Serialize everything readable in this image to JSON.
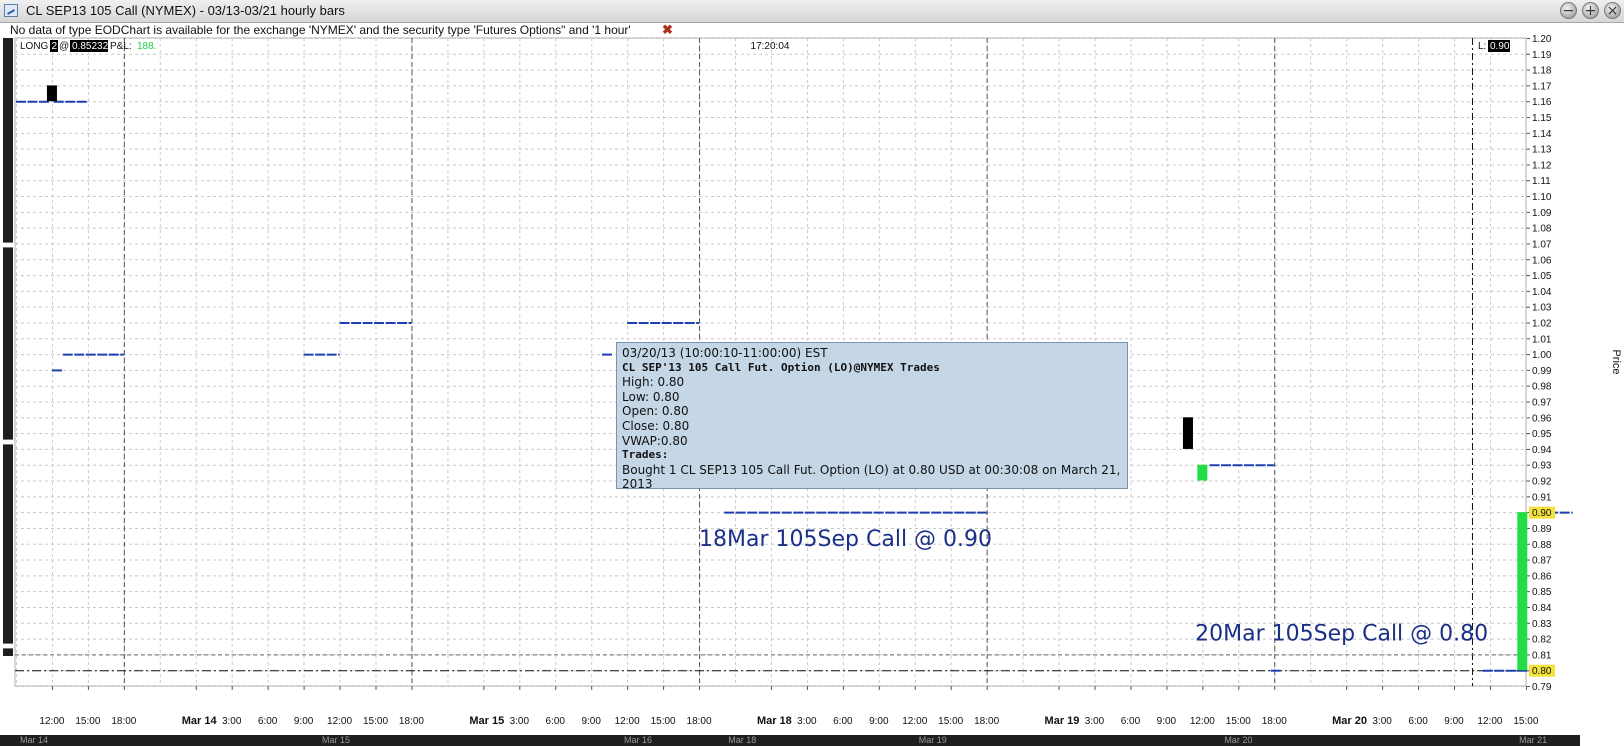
{
  "window": {
    "title": "CL SEP13 105 Call (NYMEX) - 03/13-03/21 hourly bars",
    "minimize_glyph": "−",
    "maximize_glyph": "+",
    "close_glyph": "×"
  },
  "notice": {
    "text": "No data of type EODChart is available for the exchange 'NYMEX' and the security type 'Futures Options\" and '1 hour'",
    "close_glyph": "✖"
  },
  "position_bar": {
    "side": "LONG",
    "qty": "2",
    "at": "@",
    "avg_price": "0.85232",
    "pnl_label": "P&L:",
    "pnl_value": "188."
  },
  "clock": "17:20:04",
  "last_label": "L:",
  "last_value": "0.90",
  "axis": {
    "y_title": "Price",
    "ylim": [
      0.79,
      1.2
    ],
    "y_ticks": [
      "0.79",
      "0.80",
      "0.81",
      "0.82",
      "0.83",
      "0.84",
      "0.85",
      "0.86",
      "0.87",
      "0.88",
      "0.89",
      "0.90",
      "0.91",
      "0.92",
      "0.93",
      "0.94",
      "0.95",
      "0.96",
      "0.97",
      "0.98",
      "0.99",
      "1.00",
      "1.01",
      "1.02",
      "1.03",
      "1.04",
      "1.05",
      "1.06",
      "1.07",
      "1.08",
      "1.09",
      "1.10",
      "1.11",
      "1.12",
      "1.13",
      "1.14",
      "1.15",
      "1.16",
      "1.17",
      "1.18",
      "1.19",
      "1.20"
    ],
    "price_badges": [
      {
        "value": 0.9,
        "text": "0.90"
      },
      {
        "value": 0.8,
        "text": "0.80"
      }
    ],
    "x_ticks": [
      {
        "slot": 1,
        "text": "12:00",
        "bold": false
      },
      {
        "slot": 2,
        "text": "15:00",
        "bold": false
      },
      {
        "slot": 3,
        "text": "18:00",
        "bold": false
      },
      {
        "slot": 5,
        "text": "Mar 14",
        "bold": true
      },
      {
        "slot": 6,
        "text": "3:00",
        "bold": false
      },
      {
        "slot": 7,
        "text": "6:00",
        "bold": false
      },
      {
        "slot": 8,
        "text": "9:00",
        "bold": false
      },
      {
        "slot": 9,
        "text": "12:00",
        "bold": false
      },
      {
        "slot": 10,
        "text": "15:00",
        "bold": false
      },
      {
        "slot": 11,
        "text": "18:00",
        "bold": false
      },
      {
        "slot": 13,
        "text": "Mar 15",
        "bold": true
      },
      {
        "slot": 14,
        "text": "3:00",
        "bold": false
      },
      {
        "slot": 15,
        "text": "6:00",
        "bold": false
      },
      {
        "slot": 16,
        "text": "9:00",
        "bold": false
      },
      {
        "slot": 17,
        "text": "12:00",
        "bold": false
      },
      {
        "slot": 18,
        "text": "15:00",
        "bold": false
      },
      {
        "slot": 19,
        "text": "18:00",
        "bold": false
      },
      {
        "slot": 21,
        "text": "Mar 18",
        "bold": true
      },
      {
        "slot": 22,
        "text": "3:00",
        "bold": false
      },
      {
        "slot": 23,
        "text": "6:00",
        "bold": false
      },
      {
        "slot": 24,
        "text": "9:00",
        "bold": false
      },
      {
        "slot": 25,
        "text": "12:00",
        "bold": false
      },
      {
        "slot": 26,
        "text": "15:00",
        "bold": false
      },
      {
        "slot": 27,
        "text": "18:00",
        "bold": false
      },
      {
        "slot": 29,
        "text": "Mar 19",
        "bold": true
      },
      {
        "slot": 30,
        "text": "3:00",
        "bold": false
      },
      {
        "slot": 31,
        "text": "6:00",
        "bold": false
      },
      {
        "slot": 32,
        "text": "9:00",
        "bold": false
      },
      {
        "slot": 33,
        "text": "12:00",
        "bold": false
      },
      {
        "slot": 34,
        "text": "15:00",
        "bold": false
      },
      {
        "slot": 35,
        "text": "18:00",
        "bold": false
      },
      {
        "slot": 37,
        "text": "Mar 20",
        "bold": true
      },
      {
        "slot": 38,
        "text": "3:00",
        "bold": false
      },
      {
        "slot": 39,
        "text": "6:00",
        "bold": false
      },
      {
        "slot": 40,
        "text": "9:00",
        "bold": false
      },
      {
        "slot": 41,
        "text": "12:00",
        "bold": false
      },
      {
        "slot": 42,
        "text": "15:00",
        "bold": false
      }
    ],
    "session_breaks": [
      3,
      11,
      19,
      27,
      35,
      40.5
    ]
  },
  "chart_data": {
    "type": "candlestick",
    "title": "CL SEP13 105 Call (NYMEX) - 03/13-03/21 hourly bars",
    "ylabel": "Price",
    "ylim": [
      0.79,
      1.2
    ],
    "grid": true,
    "quote_segments": [
      {
        "from": 0.0,
        "to": 0.95,
        "price": 1.16
      },
      {
        "from": 1.05,
        "to": 2.0,
        "price": 1.16
      },
      {
        "from": 1.0,
        "to": 1.3,
        "price": 0.99
      },
      {
        "from": 1.3,
        "to": 3.0,
        "price": 1.0
      },
      {
        "from": 8.0,
        "to": 9.0,
        "price": 1.0
      },
      {
        "from": 9.0,
        "to": 11.0,
        "price": 1.02
      },
      {
        "from": 16.3,
        "to": 16.6,
        "price": 1.0
      },
      {
        "from": 17.0,
        "to": 19.0,
        "price": 1.02
      },
      {
        "from": 19.7,
        "to": 27.0,
        "price": 0.9
      },
      {
        "from": 33.2,
        "to": 35.0,
        "price": 0.93
      },
      {
        "from": 34.9,
        "to": 35.2,
        "price": 0.8
      },
      {
        "from": 40.8,
        "to": 42.2,
        "price": 0.8
      },
      {
        "from": 42.3,
        "to": 43.3,
        "price": 0.9
      }
    ],
    "candles": [
      {
        "slot": 1.0,
        "open": 1.16,
        "high": 1.17,
        "low": 1.16,
        "close": 1.17,
        "color": "#000000"
      },
      {
        "slot": 32.6,
        "open": 0.94,
        "high": 0.96,
        "low": 0.94,
        "close": 0.96,
        "color": "#000000"
      },
      {
        "slot": 33.0,
        "open": 0.92,
        "high": 0.93,
        "low": 0.92,
        "close": 0.93,
        "color": "#22dd44"
      },
      {
        "slot": 41.9,
        "open": 0.8,
        "high": 0.9,
        "low": 0.8,
        "close": 0.9,
        "color": "#22dd44"
      }
    ],
    "reference_lines": [
      {
        "price": 0.8,
        "style": "dashdot"
      },
      {
        "price": 0.81,
        "style": "dashed"
      }
    ],
    "annotations": [
      {
        "slot": 19.0,
        "price": 0.88,
        "text": "18Mar 105Sep Call @ 0.90"
      },
      {
        "slot": 32.8,
        "price": 0.82,
        "text": "20Mar 105Sep Call @ 0.80"
      }
    ]
  },
  "tooltip": {
    "time": "03/20/13 (10:00:10-11:00:00) EST",
    "instrument": "CL SEP'13 105 Call Fut. Option (LO)@NYMEX Trades",
    "high": "High:  0.80",
    "low": "Low:    0.80",
    "open": "Open: 0.80",
    "close": "Close: 0.80",
    "vwap": "VWAP:0.80",
    "trades_label": "Trades:",
    "trade": "Bought 1 CL SEP13 105 Call Fut. Option (LO) at 0.80 USD at 00:30:08 on March 21, 2013"
  },
  "scroll_labels": [
    {
      "slot": 0.0,
      "text": "Mar 14"
    },
    {
      "slot": 8.4,
      "text": "Mar 15"
    },
    {
      "slot": 16.8,
      "text": "Mar 16"
    },
    {
      "slot": 19.7,
      "text": "Mar 18"
    },
    {
      "slot": 25.0,
      "text": "Mar 19"
    },
    {
      "slot": 33.5,
      "text": "Mar 20"
    },
    {
      "slot": 41.7,
      "text": "Mar 21"
    }
  ]
}
